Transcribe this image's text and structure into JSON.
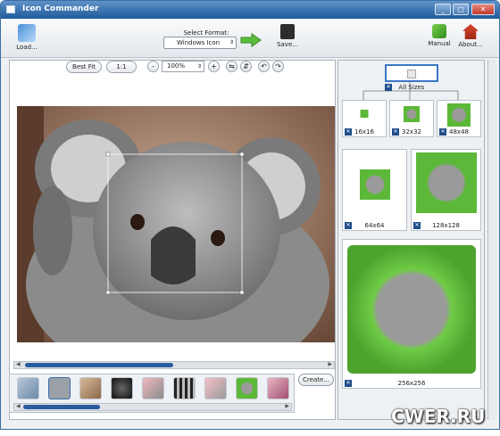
{
  "window": {
    "title": "Icon Commander"
  },
  "toolbar": {
    "load_label": "Load...",
    "select_format_label": "Select Format:",
    "format_value": "Windows Icon",
    "save_label": "Save...",
    "manual_label": "Manual",
    "about_label": "About..."
  },
  "controls": {
    "best_fit_label": "Best Fit",
    "one_to_one_label": "1:1",
    "zoom_minus": "-",
    "zoom_value": "100%",
    "zoom_plus": "+"
  },
  "preview": {
    "all_sizes_label": "All Sizes",
    "sizes": [
      "16x16",
      "32x32",
      "48x48",
      "64x64",
      "128x128",
      "256x256"
    ]
  },
  "bottom": {
    "create_label": "Create..."
  },
  "watermark": "CWER.RU",
  "colors": {
    "title_bar": "#1f5a9a",
    "scroll_thumb": "#2a5b9c",
    "leaf_green": "#5cb838"
  }
}
